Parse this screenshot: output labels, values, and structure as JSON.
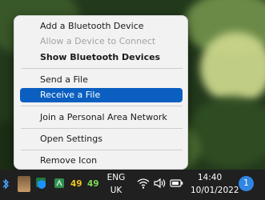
{
  "context_menu": {
    "items": [
      {
        "label": "Add a Bluetooth Device",
        "state": "normal"
      },
      {
        "label": "Allow a Device to Connect",
        "state": "disabled"
      },
      {
        "label": "Show Bluetooth Devices",
        "state": "default"
      },
      {
        "label": "Send a File",
        "state": "normal"
      },
      {
        "label": "Receive a File",
        "state": "highlighted"
      },
      {
        "label": "Join a Personal Area Network",
        "state": "normal"
      },
      {
        "label": "Open Settings",
        "state": "normal"
      },
      {
        "label": "Remove Icon",
        "state": "normal"
      }
    ]
  },
  "taskbar": {
    "tray_numbers": [
      "49",
      "49"
    ],
    "language_line1": "ENG",
    "language_line2": "UK",
    "time": "14:40",
    "date": "10/01/2022",
    "notification_count": "1"
  },
  "colors": {
    "highlight": "#0a5fc0",
    "taskbar": "#202020",
    "badge": "#2f86e4",
    "tray_number_yellow": "#f0c419",
    "tray_number_green": "#7ed957"
  }
}
